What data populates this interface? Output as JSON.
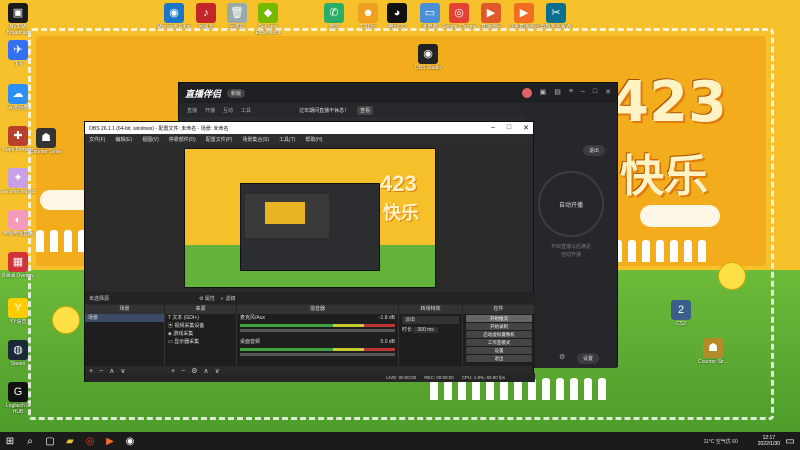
{
  "desktop": {
    "wallpaper_text_1": "423",
    "wallpaper_text_2": "快乐",
    "icons": [
      {
        "label": "NVIDIA Broadcast",
        "glyph": "▣",
        "color": "#1a1a1a"
      },
      {
        "label": "Microsoft Edge",
        "glyph": "◉",
        "color": "#1877c9"
      },
      {
        "label": "网易云",
        "glyph": "♪",
        "color": "#c2262b"
      },
      {
        "label": "回收站",
        "glyph": "🗑",
        "color": "#9aa"
      },
      {
        "label": "GeForce Experience",
        "glyph": "◆",
        "color": "#76b900"
      },
      {
        "label": "微信",
        "glyph": "✆",
        "color": "#2aae67"
      },
      {
        "label": "T3出行",
        "glyph": "☻",
        "color": "#f0a020"
      },
      {
        "label": "腾讯QQ",
        "glyph": "◕",
        "color": "#111"
      },
      {
        "label": "此电脑",
        "glyph": "▭",
        "color": "#4a90d9"
      },
      {
        "label": "Google Chrome",
        "glyph": "◎",
        "color": "#e54133"
      },
      {
        "label": "直播伴侣",
        "glyph": "▶",
        "color": "#e0582c"
      },
      {
        "label": "斗鱼直播伴侣",
        "glyph": "▶",
        "color": "#f26d21"
      },
      {
        "label": "剪映专业版 AI",
        "glyph": "✂",
        "color": "#0b6e8e"
      }
    ],
    "left_icons": [
      {
        "label": "飞书",
        "glyph": "✈",
        "color": "#3371f2"
      },
      {
        "label": "百度网盘",
        "glyph": "☁",
        "color": "#2d8ef5"
      },
      {
        "label": "Team Fortress",
        "glyph": "✚",
        "color": "#b8412c"
      },
      {
        "label": "Genshin Impact",
        "glyph": "✦",
        "color": "#c7a0e6"
      },
      {
        "label": "哔哩哔哩直播",
        "glyph": "◐",
        "color": "#f49bb9"
      },
      {
        "label": "Bilibili Overlay",
        "glyph": "▦",
        "color": "#d2323a"
      },
      {
        "label": "YY语音",
        "glyph": "Y",
        "color": "#ffcc00"
      },
      {
        "label": "Steam",
        "glyph": "◍",
        "color": "#1b2838"
      },
      {
        "label": "Logitech G HUB",
        "glyph": "G",
        "color": "#111"
      }
    ],
    "extra_icons": [
      {
        "label": "Counter Strike",
        "glyph": "☗",
        "color": "#333"
      },
      {
        "label": "OBS Studio",
        "glyph": "◉",
        "color": "#222"
      },
      {
        "label": "CS2",
        "glyph": "2",
        "color": "#3a5f8a"
      },
      {
        "label": "Counter-Str...",
        "glyph": "☗",
        "color": "#b58b2a"
      }
    ]
  },
  "livehelper": {
    "logo": "直播伴侣",
    "badge": "新版",
    "subnav": [
      "直播",
      "开播",
      "互动",
      "工具"
    ],
    "notice": "过年期间直播不休息！",
    "notice_btn": "查看",
    "mode_btn": "退出",
    "circle_text": "自动开播",
    "hint_line1": "开启直播以后满足",
    "hint_line2": "自动开播",
    "bottom_btn": "设置"
  },
  "obs": {
    "title": "OBS 26.1.1 (64-bit, windows) - 配置文件: 未命名 - 场景: 未命名",
    "menu": [
      "文件(F)",
      "编辑(E)",
      "视图(V)",
      "停靠部件(D)",
      "配置文件(P)",
      "场景集合(S)",
      "工具(T)",
      "帮助(H)"
    ],
    "no_source": "未选择源",
    "props_btn": "属性",
    "filters_btn": "滤镜",
    "dock_titles": [
      "场景",
      "来源",
      "混音器",
      "转场特效",
      "控件"
    ],
    "scenes": [
      "场景"
    ],
    "sources": [
      "文本 (GDI+)",
      "视频采集设备",
      "游戏采集",
      "显示器采集"
    ],
    "mixer": [
      {
        "name": "麦克风/Aux",
        "level": "-1.8 dB"
      },
      {
        "name": "桌面音频",
        "level": "0.0 dB"
      }
    ],
    "transition_name": "淡出",
    "duration_label": "时长",
    "duration_value": "300 ms",
    "controls": [
      "开始推流",
      "开始录制",
      "启动虚拟摄像机",
      "工作室模式",
      "设置",
      "退出"
    ],
    "status": {
      "live": "LIVE: 00:00:00",
      "rec": "REC: 00:00:00",
      "cpu": "CPU: 1.9%, 60.00 fps"
    }
  },
  "taskbar": {
    "weather": "11°C 空气优 60",
    "time": "12:17",
    "date": "2022/1/30"
  }
}
